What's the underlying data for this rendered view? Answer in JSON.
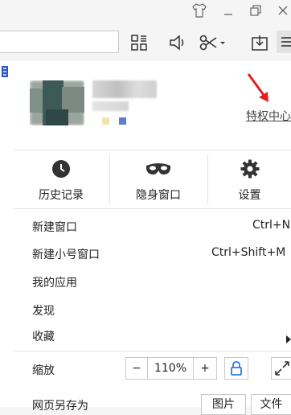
{
  "window_controls": {
    "skin_icon": "tshirt-icon",
    "minimize_icon": "minimize-icon",
    "restore_icon": "restore-icon",
    "close_icon": "close-icon"
  },
  "toolbar": {
    "address_value": "",
    "grid_icon": "apps-grid-icon",
    "sound_icon": "speaker-icon",
    "scissors_icon": "scissors-icon",
    "download_icon": "download-icon",
    "menu_icon": "menu-icon"
  },
  "profile": {
    "privilege_link": "特权中心"
  },
  "quick_actions": [
    {
      "label": "历史记录",
      "icon": "clock-icon"
    },
    {
      "label": "隐身窗口",
      "icon": "mask-icon"
    },
    {
      "label": "设置",
      "icon": "gear-icon"
    }
  ],
  "menu": {
    "new_window": {
      "label": "新建窗口",
      "shortcut": "Ctrl+N"
    },
    "new_small_window": {
      "label": "新建小号窗口",
      "shortcut": "Ctrl+Shift+M"
    },
    "my_apps": {
      "label": "我的应用"
    },
    "discover": {
      "label": "发现"
    },
    "favorites": {
      "label": "收藏"
    },
    "zoom": {
      "label": "缩放",
      "minus": "−",
      "level": "110%",
      "plus": "+"
    },
    "save_page": {
      "label": "网页另存为",
      "btn_image": "图片",
      "btn_file": "文件"
    }
  },
  "colors": {
    "accent_blue": "#2f7be3",
    "arrow_red": "#e02020",
    "left_mark_blue": "#2a57c9"
  }
}
